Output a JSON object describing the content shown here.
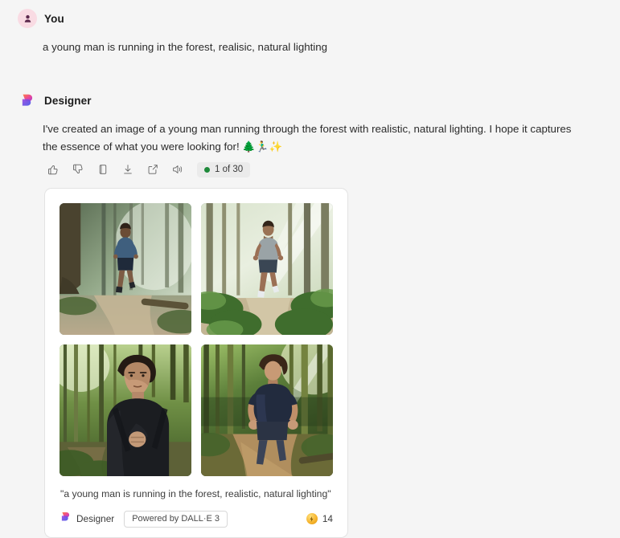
{
  "conversation": {
    "user_message": {
      "sender": "You",
      "avatar_icon": "person-avatar-icon",
      "text": "a young man is running in the forest, realisic, natural lighting"
    },
    "bot_message": {
      "sender": "Designer",
      "avatar_icon": "designer-logo-icon",
      "text": "I've created an image of a young man running through the forest with realistic, natural lighting. I hope it captures the essence of what you were looking for! 🌲🏃‍♂️✨"
    }
  },
  "actions": {
    "like": {
      "label": "Like",
      "icon": "thumbs-up-icon"
    },
    "dislike": {
      "label": "Dislike",
      "icon": "thumbs-down-icon"
    },
    "copy": {
      "label": "Copy",
      "icon": "copy-icon"
    },
    "download": {
      "label": "Download",
      "icon": "download-icon"
    },
    "share": {
      "label": "Share",
      "icon": "share-icon"
    },
    "speak": {
      "label": "Read aloud",
      "icon": "speaker-icon"
    },
    "counter": {
      "text": "1 of 30",
      "dot_color": "#1f8a3b",
      "background": "#ebebeb"
    }
  },
  "image_card": {
    "caption": "\"a young man is running in the forest, realistic, natural lighting\"",
    "brand": {
      "name": "Designer",
      "icon": "designer-logo-icon"
    },
    "powered_by": "Powered by DALL·E 3",
    "credits": {
      "icon": "coin-icon",
      "count": "14"
    },
    "images": [
      {
        "alt": "Man in blue jacket running on forest trail with misty sunlight",
        "shirt_color": "#3f5f7e",
        "shorts_color": "#1f2a3a",
        "ground_color": "#b9a88a",
        "canopy_color": "#9fb089",
        "haze_color": "#e7eee2"
      },
      {
        "alt": "Man in gray t-shirt running through sunlit fern-covered forest",
        "shirt_color": "#9aa3a6",
        "shorts_color": "#3a4654",
        "ground_color": "#c3b594",
        "canopy_color": "#a7ba8c",
        "haze_color": "#eef3e8"
      },
      {
        "alt": "Close-up of dark-haired man in black jacket running through green forest",
        "shirt_color": "#1b1d21",
        "shorts_color": "#15171a",
        "ground_color": "#6d6a4b",
        "canopy_color": "#5f7a3e",
        "haze_color": "#cfe0b4"
      },
      {
        "alt": "Man in navy t-shirt running on sunlit forest path",
        "shirt_color": "#222b3e",
        "shorts_color": "#2b3344",
        "ground_color": "#b08e5e",
        "canopy_color": "#4e7136",
        "haze_color": "#cfe3ae"
      }
    ]
  }
}
